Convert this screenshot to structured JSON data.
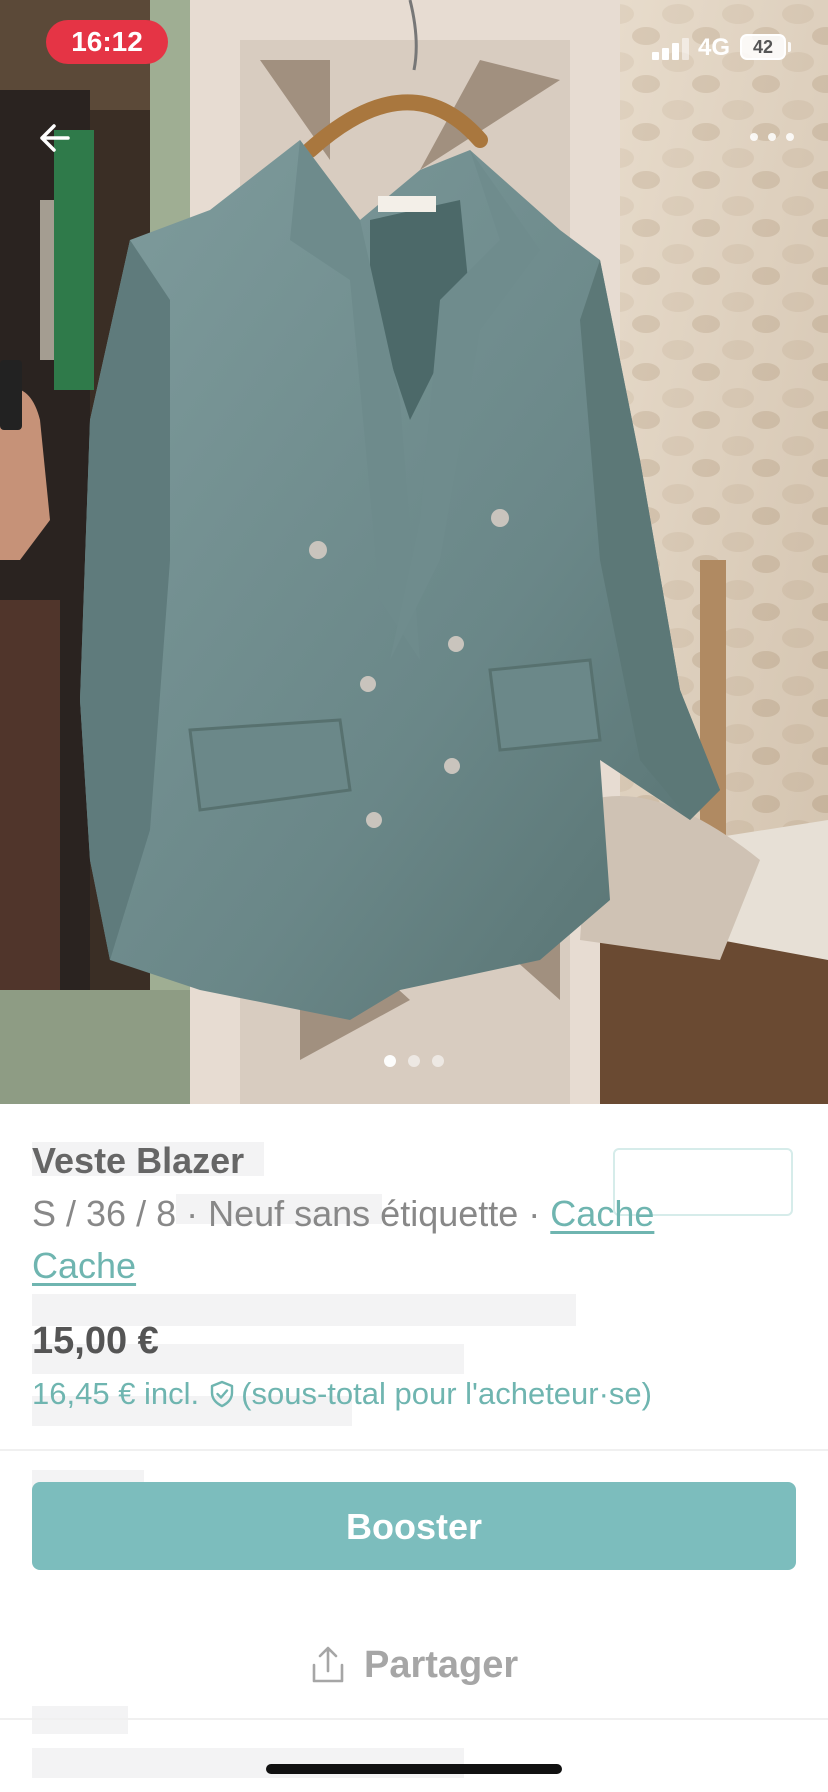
{
  "status_bar": {
    "time": "16:12",
    "network": "4G",
    "battery": "42"
  },
  "photo": {
    "description_icon": "blazer-photo",
    "page_dots": 3,
    "active_dot": 0
  },
  "item": {
    "title": "Veste Blazer",
    "size": "S / 36 / 8",
    "separator": " · ",
    "condition": "Neuf sans étiquette",
    "brand": "Cache Cache"
  },
  "pricing": {
    "price": "15,00 €",
    "price_incl": "16,45 € incl.",
    "buyer_note": "(sous-total pour l'acheteur·se)"
  },
  "actions": {
    "booster_label": "Booster",
    "share_label": "Partager"
  },
  "colors": {
    "accent": "#7cbdbd",
    "link": "#6fb5b0",
    "time_pill": "#e53445"
  }
}
